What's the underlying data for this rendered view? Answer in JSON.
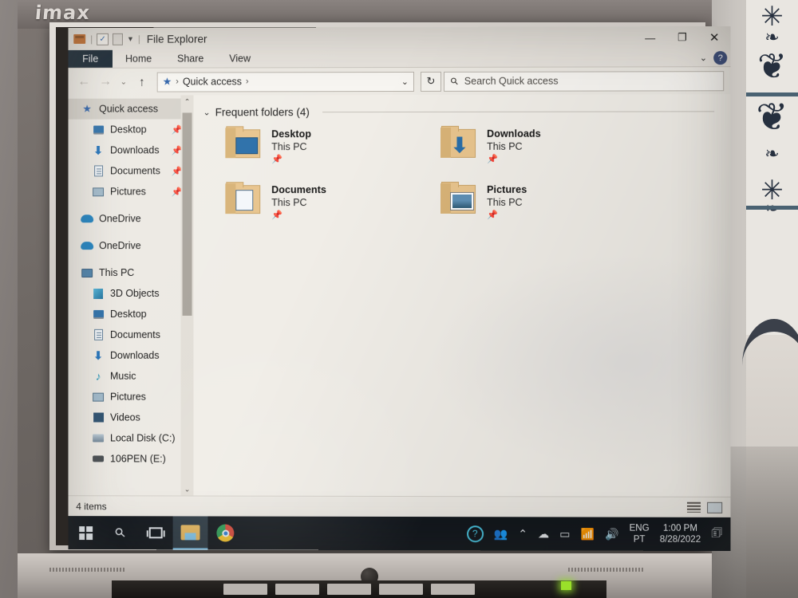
{
  "environment": {
    "monitor_brand": "imax"
  },
  "window": {
    "title": "File Explorer",
    "quick_access_toolbar": [
      {
        "name": "folder-icon",
        "label": ""
      },
      {
        "name": "properties-icon",
        "label": ""
      },
      {
        "name": "new-folder-icon",
        "label": ""
      },
      {
        "name": "customize-caret",
        "label": "▾"
      }
    ],
    "controls": {
      "minimize": "—",
      "maximize": "❐",
      "close": "✕",
      "ribbon_toggle": "⌄",
      "help": "?"
    }
  },
  "ribbon": {
    "tabs": [
      {
        "label": "File",
        "active": true
      },
      {
        "label": "Home",
        "active": false
      },
      {
        "label": "Share",
        "active": false
      },
      {
        "label": "View",
        "active": false
      }
    ]
  },
  "address_bar": {
    "back": "←",
    "forward": "→",
    "recent_caret": "⌄",
    "up": "↑",
    "breadcrumb": [
      {
        "label": "Quick access"
      }
    ],
    "breadcrumb_sep": "›",
    "dropdown_caret": "⌄",
    "refresh": "↻"
  },
  "search": {
    "placeholder": "Search Quick access",
    "value": "",
    "icon": "search-icon"
  },
  "sidebar": {
    "items": [
      {
        "label": "Quick access",
        "icon": "star-icon",
        "indent": 0,
        "selected": true,
        "pinned": false
      },
      {
        "label": "Desktop",
        "icon": "desktop-icon",
        "indent": 1,
        "selected": false,
        "pinned": true
      },
      {
        "label": "Downloads",
        "icon": "download-icon",
        "indent": 1,
        "selected": false,
        "pinned": true
      },
      {
        "label": "Documents",
        "icon": "document-icon",
        "indent": 1,
        "selected": false,
        "pinned": true
      },
      {
        "label": "Pictures",
        "icon": "picture-icon",
        "indent": 1,
        "selected": false,
        "pinned": true
      },
      {
        "label": "OneDrive",
        "icon": "cloud-icon",
        "indent": 0,
        "selected": false,
        "pinned": false
      },
      {
        "label": "OneDrive",
        "icon": "cloud-icon",
        "indent": 0,
        "selected": false,
        "pinned": false
      },
      {
        "label": "This PC",
        "icon": "computer-icon",
        "indent": 0,
        "selected": false,
        "pinned": false
      },
      {
        "label": "3D Objects",
        "icon": "3d-objects-icon",
        "indent": 1,
        "selected": false,
        "pinned": false
      },
      {
        "label": "Desktop",
        "icon": "desktop-icon",
        "indent": 1,
        "selected": false,
        "pinned": false
      },
      {
        "label": "Documents",
        "icon": "document-icon",
        "indent": 1,
        "selected": false,
        "pinned": false
      },
      {
        "label": "Downloads",
        "icon": "download-icon",
        "indent": 1,
        "selected": false,
        "pinned": false
      },
      {
        "label": "Music",
        "icon": "music-icon",
        "indent": 1,
        "selected": false,
        "pinned": false
      },
      {
        "label": "Pictures",
        "icon": "picture-icon",
        "indent": 1,
        "selected": false,
        "pinned": false
      },
      {
        "label": "Videos",
        "icon": "video-icon",
        "indent": 1,
        "selected": false,
        "pinned": false
      },
      {
        "label": "Local Disk (C:)",
        "icon": "disk-icon",
        "indent": 1,
        "selected": false,
        "pinned": false
      },
      {
        "label": "106PEN (E:)",
        "icon": "usb-drive-icon",
        "indent": 1,
        "selected": false,
        "pinned": false
      }
    ],
    "pin_glyph": "📌",
    "scroll_up": "⌃",
    "scroll_down": "⌄"
  },
  "content": {
    "group": {
      "chevron": "⌄",
      "title": "Frequent folders (4)"
    },
    "folders": [
      {
        "name": "Desktop",
        "location": "This PC",
        "badge": "desktop-badge",
        "pinned": true
      },
      {
        "name": "Downloads",
        "location": "This PC",
        "badge": "download-badge",
        "pinned": true
      },
      {
        "name": "Documents",
        "location": "This PC",
        "badge": "document-badge",
        "pinned": true
      },
      {
        "name": "Pictures",
        "location": "This PC",
        "badge": "picture-badge",
        "pinned": true
      }
    ],
    "pin_glyph": "📌"
  },
  "status_bar": {
    "item_count": "4 items",
    "view_details": "details-view-icon",
    "view_large": "large-icons-view-icon"
  },
  "taskbar": {
    "buttons": [
      {
        "name": "start-button",
        "label": ""
      },
      {
        "name": "search-button",
        "label": ""
      },
      {
        "name": "task-view-button",
        "label": ""
      },
      {
        "name": "file-explorer-button",
        "label": "",
        "active": true
      },
      {
        "name": "chrome-button",
        "label": ""
      }
    ],
    "tray": {
      "help_icon": "?",
      "people_icon": "people-icon",
      "show_hidden": "⌃",
      "onedrive_icon": "onedrive-tray-icon",
      "battery_icon": "battery-icon",
      "wifi_icon": "wifi-icon",
      "volume_icon": "volume-icon",
      "language": "ENG",
      "language_sub": "PT",
      "time": "1:00 PM",
      "date": "8/28/2022",
      "notifications_icon": "notifications-icon"
    }
  },
  "colors": {
    "accent": "#2a5fa8",
    "taskbar": "#11161c",
    "file_tab": "#12212e",
    "folder": "#e8c48d",
    "window_chrome": "#ece9e3"
  }
}
